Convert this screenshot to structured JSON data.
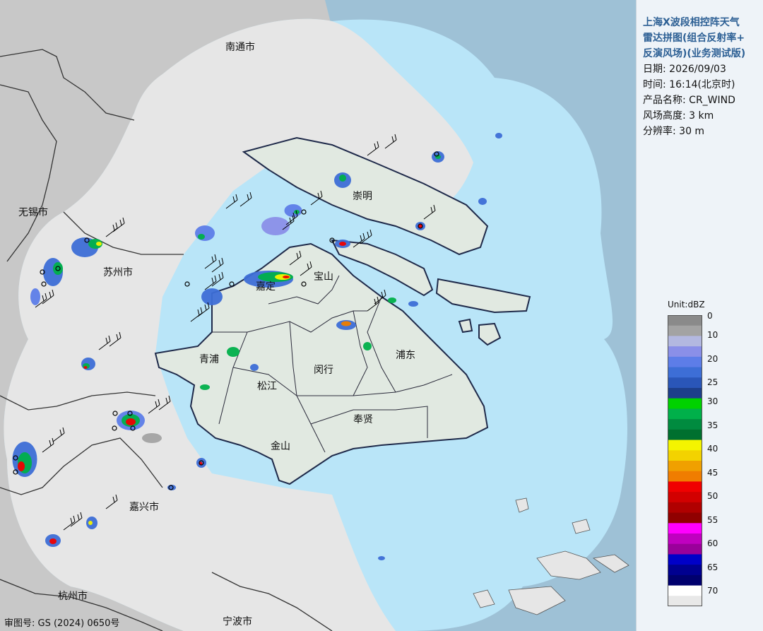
{
  "panel": {
    "title_lines": [
      "上海X波段相控阵天气",
      "雷达拼图(组合反射率+",
      "反演风场)(业务测试版)"
    ],
    "info": [
      "日期: 2026/09/03",
      "时间: 16:14(北京时)",
      "产品名称: CR_WIND",
      "风场高度: 3 km",
      "分辨率: 30 m"
    ]
  },
  "legend": {
    "unit": "Unit:dBZ",
    "ticks": [
      "0",
      "10",
      "20",
      "25",
      "30",
      "35",
      "40",
      "45",
      "50",
      "55",
      "60",
      "65",
      "70"
    ],
    "colors": [
      "#8a8a8a",
      "#a3a3a3",
      "#b3b8e0",
      "#8a8fe8",
      "#5d7de8",
      "#3d6ed6",
      "#2a56b8",
      "#1d3f8a",
      "#00d200",
      "#00b04a",
      "#008b3f",
      "#00702f",
      "#f4f400",
      "#f3d200",
      "#f0a000",
      "#f07d00",
      "#f00000",
      "#d20000",
      "#b00000",
      "#900000",
      "#ff00ff",
      "#c000c0",
      "#9a009a",
      "#0000c8",
      "#000090",
      "#00006e",
      "#ffffff",
      "#e8e8e8"
    ]
  },
  "map": {
    "colors": {
      "sea": "#9ec1d6",
      "radar_coverage": "#b9e5f8",
      "land_outside": "#c8c8c8",
      "coverage_land": "#e6e6e6",
      "shanghai": "#e1e9e1"
    },
    "city_labels": [
      "南通市",
      "无锡市",
      "苏州市",
      "嘉兴市",
      "杭州市",
      "宁波市"
    ],
    "district_labels": [
      "崇明",
      "宝山",
      "嘉定",
      "青浦",
      "闵行",
      "浦东",
      "松江",
      "奉贤",
      "金山"
    ]
  },
  "approval": "审图号: GS (2024) 0650号"
}
